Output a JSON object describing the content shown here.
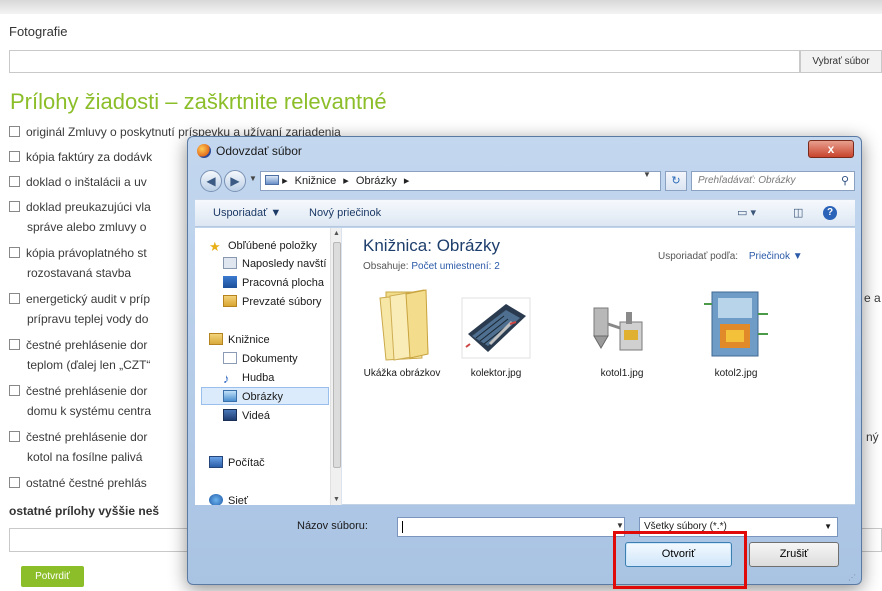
{
  "form": {
    "photos_label": "Fotografie",
    "choose_file": "Vybrať súbor",
    "attachments_heading": "Prílohy žiadosti – zaškrtnite relevantné",
    "checks": [
      {
        "l1": "originál Zmluvy o poskytnutí príspevku a užívaní zariadenia",
        "l2": ""
      },
      {
        "l1": "kópia faktúry za dodávk",
        "l2": ""
      },
      {
        "l1": "doklad o inštalácii a uv",
        "l2": ""
      },
      {
        "l1": "doklad preukazujúci vla",
        "l2": "správe alebo zmluvy o"
      },
      {
        "l1": "kópia právoplatného st",
        "l2": "rozostavaná stavba"
      },
      {
        "l1": "energetický audit v príp",
        "l2": "prípravu teplej vody do"
      },
      {
        "l1": "čestné prehlásenie dor",
        "l2": "teplom (ďalej len „CZT“"
      },
      {
        "l1": "čestné prehlásenie dor",
        "l2": "domu k systému centra"
      },
      {
        "l1": "čestné prehlásenie dor",
        "l2": "kotol na fosílne palivá"
      },
      {
        "l1": "ostatné čestné prehlás",
        "l2": ""
      }
    ],
    "right_frag_1": "e a",
    "right_frag_2": "ný",
    "other_attachments": "ostatné prílohy vyššie neš",
    "submit": "Potvrdiť"
  },
  "dialog": {
    "title": "Odovzdať súbor",
    "close": "x",
    "breadcrumb": [
      "Knižnice",
      "Obrázky"
    ],
    "search_placeholder": "Prehľadávať: Obrázky",
    "toolbar": {
      "organize": "Usporiadať ▼",
      "new_folder": "Nový priečinok"
    },
    "nav": {
      "favorites": "Obľúbené položky",
      "recent": "Naposledy navští",
      "desktop": "Pracovná plocha",
      "downloads": "Prevzaté súbory",
      "libraries": "Knižnice",
      "documents": "Dokumenty",
      "music": "Hudba",
      "pictures": "Obrázky",
      "videos": "Videá",
      "computer": "Počítač",
      "network": "Sieť"
    },
    "library_title": "Knižnica: Obrázky",
    "contains_label": "Obsahuje:",
    "contains_link": "Počet umiestnení: 2",
    "arrange_label": "Usporiadať podľa:",
    "arrange_value": "Priečinok ▼",
    "files": [
      "Ukážka obrázkov",
      "kolektor.jpg",
      "kotol1.jpg",
      "kotol2.jpg"
    ],
    "filename_label": "Názov súboru:",
    "filter_value": "Všetky súbory (*.*)",
    "open": "Otvoriť",
    "cancel": "Zrušiť"
  },
  "colors": {
    "accent": "#8cbe2a",
    "highlight": "#e10a0a"
  }
}
